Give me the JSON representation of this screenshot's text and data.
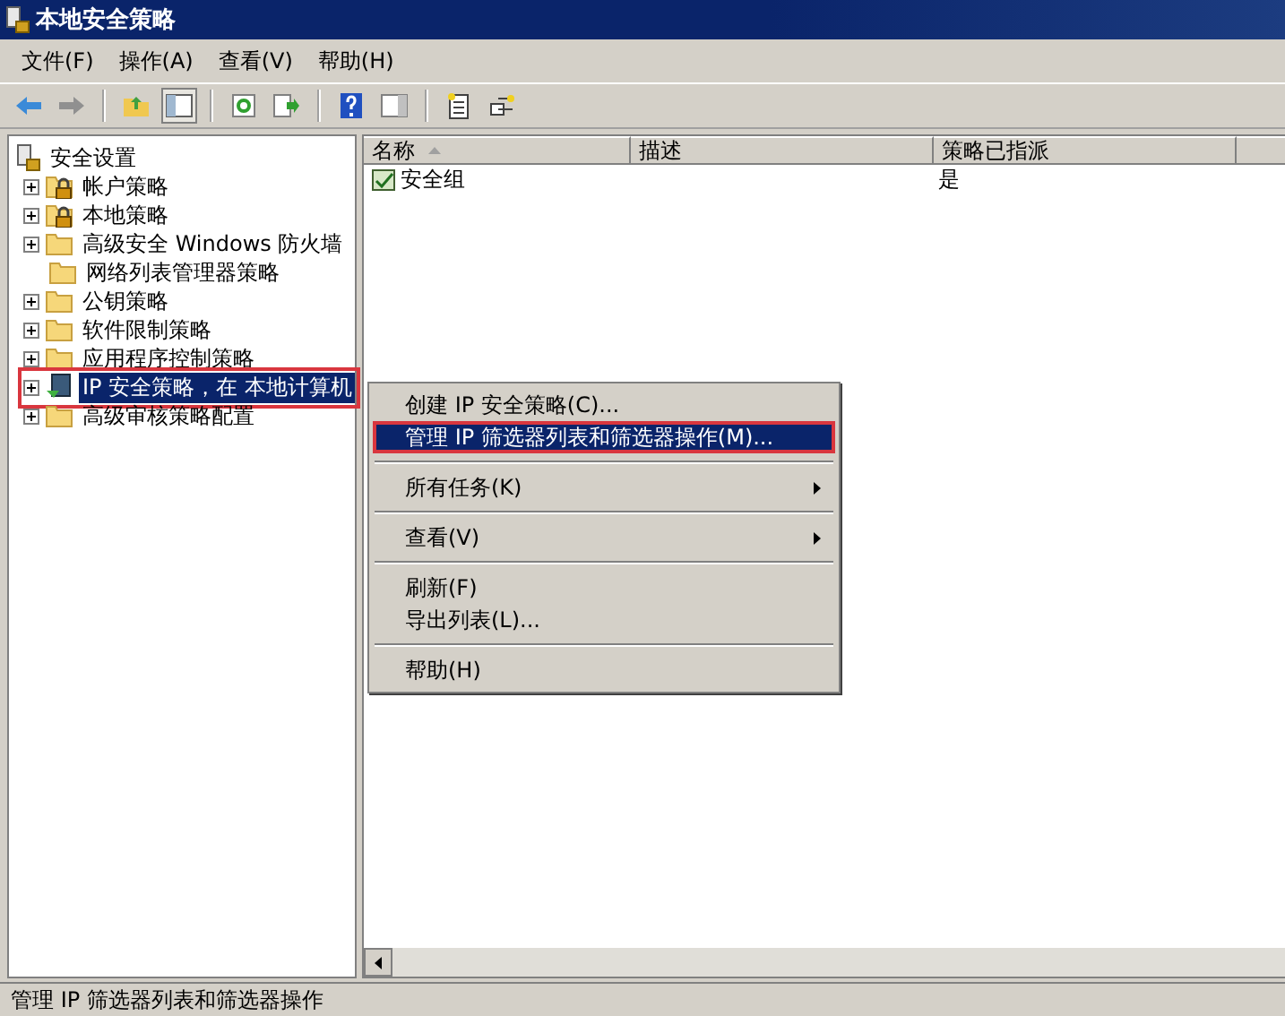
{
  "window": {
    "title": "本地安全策略"
  },
  "menu_bar": [
    "文件(F)",
    "操作(A)",
    "查看(V)",
    "帮助(H)"
  ],
  "tree": {
    "label": "安全设置",
    "children": [
      {
        "label": "帐户策略",
        "expandable": true,
        "locked": true,
        "selected": false,
        "annotated": false
      },
      {
        "label": "本地策略",
        "expandable": true,
        "locked": true,
        "selected": false,
        "annotated": false
      },
      {
        "label": "高级安全 Windows 防火墙",
        "expandable": true,
        "locked": false,
        "selected": false,
        "annotated": false
      },
      {
        "label": "网络列表管理器策略",
        "expandable": false,
        "locked": false,
        "selected": false,
        "annotated": false
      },
      {
        "label": "公钥策略",
        "expandable": true,
        "locked": false,
        "selected": false,
        "annotated": false
      },
      {
        "label": "软件限制策略",
        "expandable": true,
        "locked": false,
        "selected": false,
        "annotated": false
      },
      {
        "label": "应用程序控制策略",
        "expandable": true,
        "locked": false,
        "selected": false,
        "annotated": false
      },
      {
        "label": "IP 安全策略，在 本地计算机",
        "expandable": true,
        "selected": true,
        "annotated": true,
        "kind": "ipsec"
      },
      {
        "label": "高级审核策略配置",
        "expandable": true,
        "locked": false,
        "selected": false,
        "annotated": false
      }
    ]
  },
  "table": {
    "columns": [
      {
        "label": "名称",
        "sorted": true
      },
      {
        "label": "描述",
        "sorted": false
      },
      {
        "label": "策略已指派",
        "sorted": false
      }
    ],
    "rows": [
      {
        "cells": [
          "安全组",
          "",
          "是"
        ]
      }
    ]
  },
  "context_menu": [
    {
      "kind": "item",
      "label": "创建 IP 安全策略(C)...",
      "selected": false,
      "annotated": false,
      "submenu": false
    },
    {
      "kind": "item",
      "label": "管理 IP 筛选器列表和筛选器操作(M)...",
      "selected": true,
      "annotated": true,
      "submenu": false
    },
    {
      "kind": "separator"
    },
    {
      "kind": "item",
      "label": "所有任务(K)",
      "selected": false,
      "annotated": false,
      "submenu": true
    },
    {
      "kind": "separator"
    },
    {
      "kind": "item",
      "label": "查看(V)",
      "selected": false,
      "annotated": false,
      "submenu": true
    },
    {
      "kind": "separator"
    },
    {
      "kind": "item",
      "label": "刷新(F)",
      "selected": false,
      "annotated": false,
      "submenu": false
    },
    {
      "kind": "item",
      "label": "导出列表(L)...",
      "selected": false,
      "annotated": false,
      "submenu": false
    },
    {
      "kind": "separator"
    },
    {
      "kind": "item",
      "label": "帮助(H)",
      "selected": false,
      "annotated": false,
      "submenu": false
    }
  ],
  "status_bar": "管理 IP 筛选器列表和筛选器操作"
}
